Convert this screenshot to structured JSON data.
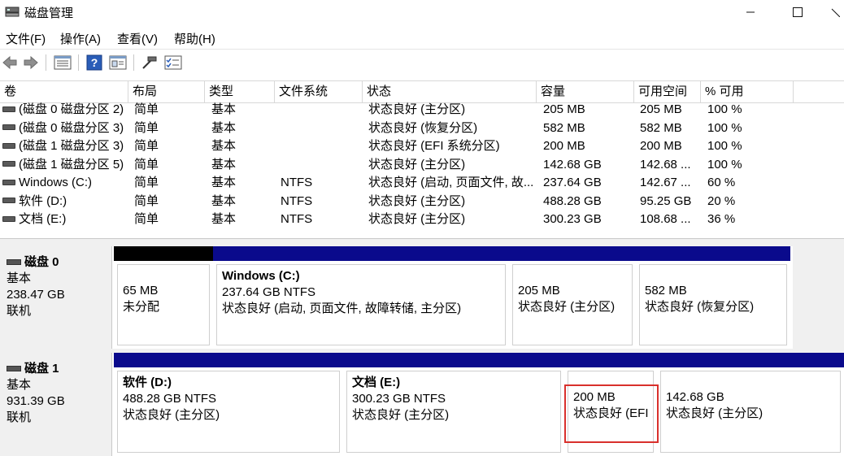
{
  "window": {
    "title": "磁盘管理"
  },
  "menu": [
    "文件(F)",
    "操作(A)",
    "查看(V)",
    "帮助(H)"
  ],
  "table": {
    "columns": [
      "卷",
      "布局",
      "类型",
      "文件系统",
      "状态",
      "容量",
      "可用空间",
      "% 可用"
    ],
    "rows": [
      [
        "(磁盘 0 磁盘分区 2)",
        "简单",
        "基本",
        "",
        "状态良好 (主分区)",
        "205 MB",
        "205 MB",
        "100 %"
      ],
      [
        "(磁盘 0 磁盘分区 3)",
        "简单",
        "基本",
        "",
        "状态良好 (恢复分区)",
        "582 MB",
        "582 MB",
        "100 %"
      ],
      [
        "(磁盘 1 磁盘分区 3)",
        "简单",
        "基本",
        "",
        "状态良好 (EFI 系统分区)",
        "200 MB",
        "200 MB",
        "100 %"
      ],
      [
        "(磁盘 1 磁盘分区 5)",
        "简单",
        "基本",
        "",
        "状态良好 (主分区)",
        "142.68 GB",
        "142.68 ...",
        "100 %"
      ],
      [
        "Windows (C:)",
        "简单",
        "基本",
        "NTFS",
        "状态良好 (启动, 页面文件, 故...",
        "237.64 GB",
        "142.67 ...",
        "60 %"
      ],
      [
        "软件 (D:)",
        "简单",
        "基本",
        "NTFS",
        "状态良好 (主分区)",
        "488.28 GB",
        "95.25 GB",
        "20 %"
      ],
      [
        "文档 (E:)",
        "简单",
        "基本",
        "NTFS",
        "状态良好 (主分区)",
        "300.23 GB",
        "108.68 ...",
        "36 %"
      ]
    ]
  },
  "disks": [
    {
      "name": "磁盘 0",
      "type": "基本",
      "size": "238.47 GB",
      "status": "联机",
      "partitions": [
        {
          "kind": "unallocated",
          "title": "",
          "size": "65 MB",
          "status": "未分配"
        },
        {
          "kind": "primary",
          "title": "Windows  (C:)",
          "size": "237.64 GB NTFS",
          "status": "状态良好 (启动, 页面文件, 故障转储, 主分区)"
        },
        {
          "kind": "primary",
          "title": "",
          "size": "205 MB",
          "status": "状态良好 (主分区)"
        },
        {
          "kind": "primary",
          "title": "",
          "size": "582 MB",
          "status": "状态良好 (恢复分区)"
        }
      ]
    },
    {
      "name": "磁盘 1",
      "type": "基本",
      "size": "931.39 GB",
      "status": "联机",
      "partitions": [
        {
          "kind": "primary",
          "title": "软件  (D:)",
          "size": "488.28 GB NTFS",
          "status": "状态良好 (主分区)"
        },
        {
          "kind": "primary",
          "title": "文档  (E:)",
          "size": "300.23 GB NTFS",
          "status": "状态良好 (主分区)"
        },
        {
          "kind": "primary",
          "title": "",
          "size": "200 MB",
          "status": "状态良好 (EFI 系统分区)"
        },
        {
          "kind": "primary",
          "title": "",
          "size": "142.68 GB",
          "status": "状态良好 (主分区)"
        }
      ]
    }
  ],
  "colors": {
    "primary_bar": "#0a0a8c",
    "unallocated_bar": "#000000",
    "highlight": "#d9302c"
  }
}
